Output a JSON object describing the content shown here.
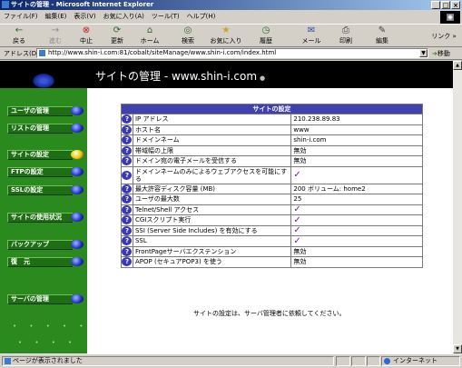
{
  "window": {
    "title": "サイトの管理 - Microsoft Internet Explorer",
    "buttons": [
      "_",
      "□",
      "×"
    ]
  },
  "menu": [
    "ファイル(F)",
    "編集(E)",
    "表示(V)",
    "お気に入り(A)",
    "ツール(T)",
    "ヘルプ(H)"
  ],
  "toolbar": {
    "back": "戻る",
    "forward": "進む",
    "stop": "中止",
    "refresh": "更新",
    "home": "ホーム",
    "search": "検索",
    "favorites": "お気に入り",
    "history": "履歴",
    "mail": "メール",
    "print": "印刷",
    "edit": "編集",
    "links": "リンク"
  },
  "address": {
    "label": "アドレス(D)",
    "url": "http://www.shin-i.com:81/cobalt/siteManage/www.shin-i.com/index.html",
    "go": "移動"
  },
  "page": {
    "title": "サイトの管理 - www.shin-i.com",
    "title_dot": "●"
  },
  "sidebar": [
    {
      "label": "ユーザの管理",
      "active": false
    },
    {
      "label": "リストの管理",
      "active": false
    },
    {
      "label": "サイトの設定",
      "active": true
    },
    {
      "label": "FTPの設定",
      "active": false
    },
    {
      "label": "SSLの設定",
      "active": false
    },
    {
      "label": "サイトの使用状況",
      "active": false
    },
    {
      "label": "バックアップ",
      "active": false
    },
    {
      "label": "復　元",
      "active": false
    },
    {
      "label": "サーバの管理",
      "active": false
    }
  ],
  "settings": {
    "header": "サイトの設定",
    "rows": [
      {
        "label": "IP アドレス",
        "value": "210.238.89.83"
      },
      {
        "label": "ホスト名",
        "value": "www"
      },
      {
        "label": "ドメインネーム",
        "value": "shin-i.com"
      },
      {
        "label": "帯域幅の上限",
        "value": "無効"
      },
      {
        "label": "ドメイン宛の電子メールを受信する",
        "value": "無効"
      },
      {
        "label": "ドメインネームのみによるウェブアクセスを可能にする",
        "value": "✓"
      },
      {
        "label": "最大許容ディスク容量 (MB)",
        "value": "200 ボリューム: home2"
      },
      {
        "label": "ユーザの最大数",
        "value": "25"
      },
      {
        "label": "Telnet/Shell アクセス",
        "value": "✓"
      },
      {
        "label": "CGIスクリプト実行",
        "value": "✓"
      },
      {
        "label": "SSI (Server Side Includes) を有効にする",
        "value": "✓"
      },
      {
        "label": "SSL",
        "value": "✓"
      },
      {
        "label": "FrontPageサーバエクステンション",
        "value": "無効"
      },
      {
        "label": "APOP (セキュアPOP3) を使う",
        "value": "無効"
      }
    ],
    "help_glyph": "?",
    "footnote": "サイトの設定は、サーバ管理者に依頼してください。"
  },
  "status": {
    "text": "ページが表示されました",
    "zone": "インターネット"
  }
}
